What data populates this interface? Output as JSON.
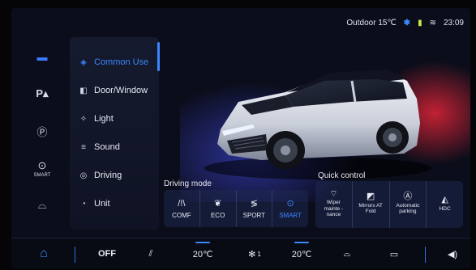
{
  "status_bar": {
    "outdoor": "Outdoor 15℃",
    "time": "23:09",
    "icons": [
      "bluetooth-icon",
      "battery-icon",
      "wifi-icon"
    ]
  },
  "rail": {
    "items": [
      {
        "name": "car-icon",
        "label": "",
        "active": true
      },
      {
        "name": "park-assist-icon",
        "label": ""
      },
      {
        "name": "parking-icon",
        "label": ""
      },
      {
        "name": "smart-icon",
        "label": "SMART"
      },
      {
        "name": "car-side-icon",
        "label": ""
      }
    ]
  },
  "menu": {
    "items": [
      {
        "label": "Common Use",
        "icon": "layers-icon",
        "active": true
      },
      {
        "label": "Door/Window",
        "icon": "door-icon"
      },
      {
        "label": "Light",
        "icon": "light-icon"
      },
      {
        "label": "Sound",
        "icon": "sound-icon"
      },
      {
        "label": "Driving",
        "icon": "driving-icon"
      },
      {
        "label": "Unit",
        "icon": "unit-icon"
      }
    ]
  },
  "driving_mode": {
    "title": "Driving mode",
    "modes": [
      {
        "label": "COMF",
        "icon": "comfort-icon"
      },
      {
        "label": "ECO",
        "icon": "eco-leaf-icon"
      },
      {
        "label": "SPORT",
        "icon": "sport-icon"
      },
      {
        "label": "SMART",
        "icon": "smart-mode-icon",
        "active": true
      }
    ]
  },
  "quick_control": {
    "title": "Quick control",
    "items": [
      {
        "label": "Wiper mainte -nance",
        "icon": "wiper-icon"
      },
      {
        "label": "Mirrors AT Fold",
        "icon": "mirror-icon"
      },
      {
        "label": "Automatic parking",
        "icon": "auto-park-icon"
      },
      {
        "label": "HDC",
        "icon": "hdc-icon"
      }
    ]
  },
  "bottom_bar": {
    "ac_state": "OFF",
    "left_temp": "20℃",
    "fan_level": "1",
    "right_temp": "20℃"
  },
  "colors": {
    "accent": "#3d86ff",
    "background": "#0b0d1a",
    "glow_red": "#ff2840",
    "glow_blue": "#4650ff"
  }
}
